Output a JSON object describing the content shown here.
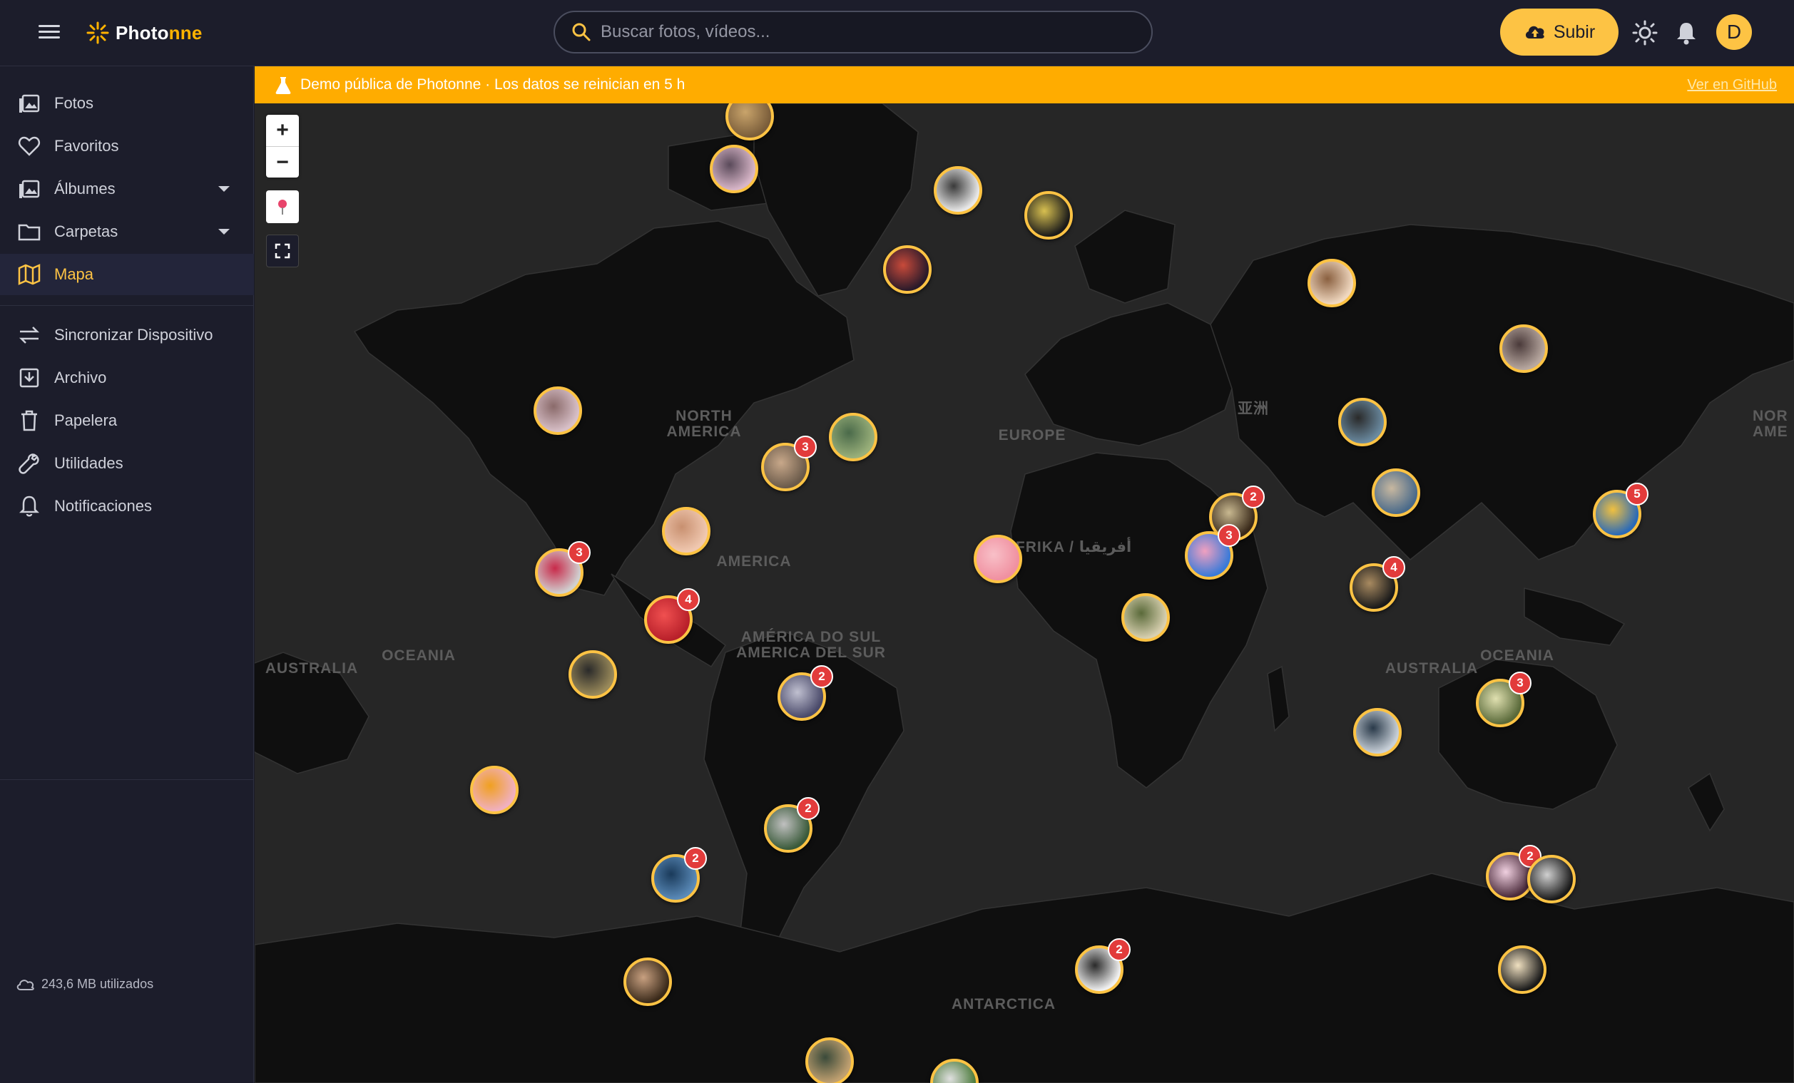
{
  "app": {
    "name_part1": "Photo",
    "name_part2": "nne"
  },
  "search": {
    "placeholder": "Buscar fotos, vídeos..."
  },
  "header": {
    "upload_label": "Subir",
    "avatar_initial": "D"
  },
  "sidebar": {
    "items": [
      {
        "label": "Fotos",
        "icon": "photos-icon"
      },
      {
        "label": "Favoritos",
        "icon": "heart-icon"
      },
      {
        "label": "Álbumes",
        "icon": "albums-icon"
      },
      {
        "label": "Carpetas",
        "icon": "folder-icon"
      },
      {
        "label": "Mapa",
        "icon": "map-icon"
      },
      {
        "label": "Sincronizar Dispositivo",
        "icon": "sync-icon"
      },
      {
        "label": "Archivo",
        "icon": "archive-icon"
      },
      {
        "label": "Papelera",
        "icon": "trash-icon"
      },
      {
        "label": "Utilidades",
        "icon": "wrench-icon"
      },
      {
        "label": "Notificaciones",
        "icon": "bell-icon"
      }
    ],
    "storage": "243,6 MB utilizados"
  },
  "banner": {
    "text": "Demo pública de Photonne · Los datos se reinician en 5 h",
    "link": "Ver en GitHub"
  },
  "map": {
    "labels": {
      "north_america": "NORTH AMERICA",
      "america": "AMERICA",
      "south_america": "AMÉRICA DO SUL AMERICA DEL SUR",
      "europe": "EUROPE",
      "africa": "AFRIKA / أفريقيا",
      "asia": "亚洲",
      "australia_left": "AUSTRALIA",
      "oceania_left": "OCEANIA",
      "australia": "AUSTRALIA",
      "oceania": "OCEANIA",
      "antarctica": "ANTARCTICA",
      "north_america_right": "NOR AME"
    },
    "zoom_in": "+",
    "zoom_out": "−",
    "cluster_counts": [
      "3",
      "3",
      "4",
      "2",
      "2",
      "2",
      "2",
      "3",
      "2",
      "4",
      "5",
      "3",
      "2"
    ]
  }
}
